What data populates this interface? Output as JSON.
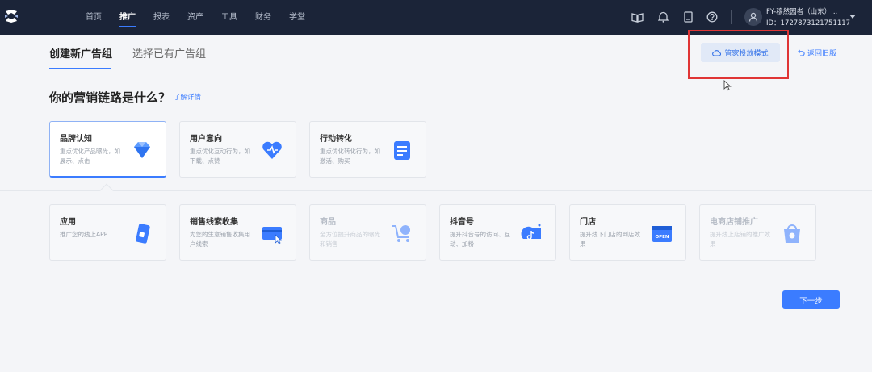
{
  "topbar": {
    "nav": [
      {
        "label": "首页",
        "active": false
      },
      {
        "label": "推广",
        "active": true
      },
      {
        "label": "报表",
        "active": false
      },
      {
        "label": "资产",
        "active": false
      },
      {
        "label": "工具",
        "active": false
      },
      {
        "label": "财务",
        "active": false
      },
      {
        "label": "学堂",
        "active": false
      }
    ],
    "icons": [
      "book-icon",
      "bell-icon",
      "tablet-icon",
      "help-icon"
    ],
    "account": {
      "name": "FY-穆然园者（山东）...",
      "id": "ID：1727873121751117"
    }
  },
  "tabs": {
    "create": "创建新广告组",
    "select": "选择已有广告组"
  },
  "steward_button": "管家投放模式",
  "old_version_link": "返回旧版",
  "question": "你的营销链路是什么？",
  "detail_link": "了解详情",
  "goal_cards": [
    {
      "title": "品牌认知",
      "desc": "重点优化产品曝光，如展示、点击",
      "icon": "diamond-icon",
      "selected": true
    },
    {
      "title": "用户意向",
      "desc": "重点优化互动行为，如下载、点赞",
      "icon": "heart-icon",
      "selected": false
    },
    {
      "title": "行动转化",
      "desc": "重点优化转化行为，如激活、购买",
      "icon": "form-icon",
      "selected": false
    }
  ],
  "target_cards": [
    {
      "title": "应用",
      "desc": "推广您的线上APP",
      "icon": "app-phone-icon",
      "disabled": false
    },
    {
      "title": "销售线索收集",
      "desc": "为您的生意销售收集用户线索",
      "icon": "lead-card-icon",
      "disabled": false
    },
    {
      "title": "商品",
      "desc": "全方位提升商品的曝光和销售",
      "icon": "cart-icon",
      "disabled": true
    },
    {
      "title": "抖音号",
      "desc": "提升抖音号的访问、互动、加粉",
      "icon": "douyin-icon",
      "disabled": false
    },
    {
      "title": "门店",
      "desc": "提升线下门店的到店效果",
      "icon": "store-open-icon",
      "disabled": false,
      "badge": "OPEN"
    },
    {
      "title": "电商店铺推广",
      "desc": "提升线上店铺的推广效果",
      "icon": "shop-bag-icon",
      "disabled": true
    }
  ],
  "next_button": "下一步",
  "colors": {
    "accent": "#3b7cff",
    "nav_bg": "#1b2438",
    "highlight": "#e03535"
  }
}
